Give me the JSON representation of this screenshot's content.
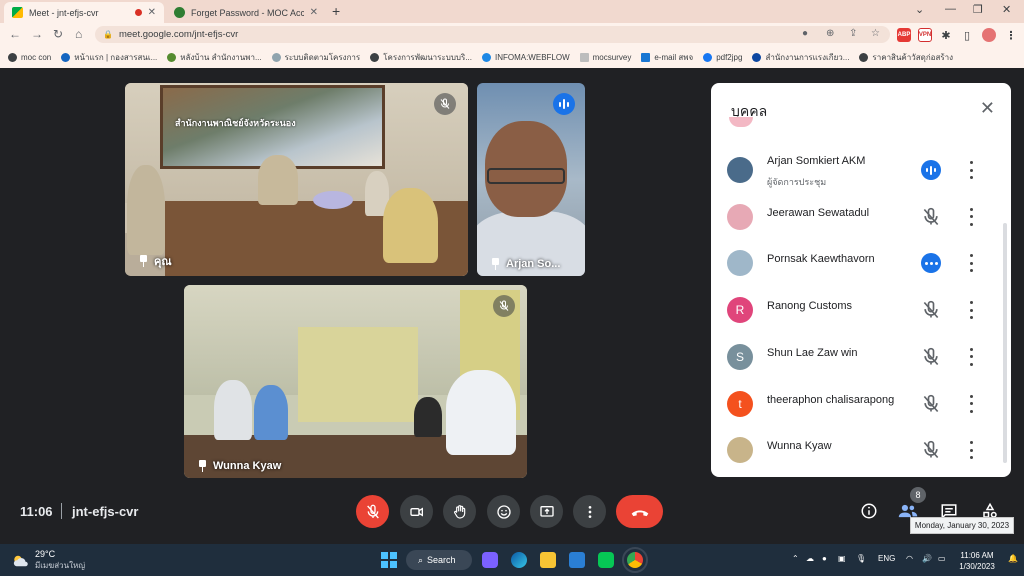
{
  "browser": {
    "tabs": [
      {
        "title": "Meet - jnt-efjs-cvr",
        "active": true
      },
      {
        "title": "Forget Password - MOC Account",
        "active": false
      }
    ],
    "url": "meet.google.com/jnt-efjs-cvr",
    "bookmarks": [
      "moc con",
      "หน้าแรก | กองสารสนเ...",
      "หลังบ้าน สำนักงานพา...",
      "ระบบติดตามโครงการ",
      "โครงการพัฒนาระบบบริ...",
      "INFOMA:WEBFLOW",
      "mocsurvey",
      "e-mail สพจ",
      "pdf2jpg",
      "สำนักงานการแรงเกียว...",
      "ราคาสินค้าวัสดุก่อสร้าง"
    ],
    "extensions": [
      "ABP",
      "VPN"
    ]
  },
  "tiles": {
    "tile1": {
      "name": "คุณ",
      "poster_text": "สำนักงานพาณิชย์จังหวัดระนอง"
    },
    "tile2": {
      "name": "Arjan So..."
    },
    "tile3": {
      "name": "Wunna Kyaw"
    }
  },
  "people_panel": {
    "title": "บุคคล",
    "participants": [
      {
        "name": "Arjan Somkiert AKM",
        "role": "ผู้จัดการประชุม",
        "status": "speaking",
        "avatar_color": "#4a6b8a",
        "initial": ""
      },
      {
        "name": "Jeerawan Sewatadul",
        "role": "",
        "status": "muted",
        "avatar_color": "#e7a9b5",
        "initial": ""
      },
      {
        "name": "Pornsak Kaewthavorn",
        "role": "",
        "status": "more",
        "avatar_color": "#9fb7c9",
        "initial": ""
      },
      {
        "name": "Ranong Customs",
        "role": "",
        "status": "muted",
        "avatar_color": "#e0457b",
        "initial": "R"
      },
      {
        "name": "Shun Lae Zaw win",
        "role": "",
        "status": "muted",
        "avatar_color": "#78909c",
        "initial": "S"
      },
      {
        "name": "theeraphon chalisarapong",
        "role": "",
        "status": "muted",
        "avatar_color": "#f4511e",
        "initial": "t"
      },
      {
        "name": "Wunna Kyaw",
        "role": "",
        "status": "muted",
        "avatar_color": "#c8b48a",
        "initial": ""
      }
    ]
  },
  "meeting": {
    "time": "11:06",
    "code": "jnt-efjs-cvr",
    "participant_count": "8",
    "tooltip": "Monday, January 30, 2023"
  },
  "taskbar": {
    "temperature": "29°C",
    "weather_text": "มีเมฆส่วนใหญ่",
    "search": "Search",
    "language": "ENG",
    "time": "11:06 AM",
    "date": "1/30/2023"
  },
  "colors": {
    "accent": "#1a73e8",
    "danger": "#ea4335",
    "meet_bg": "#202124"
  }
}
